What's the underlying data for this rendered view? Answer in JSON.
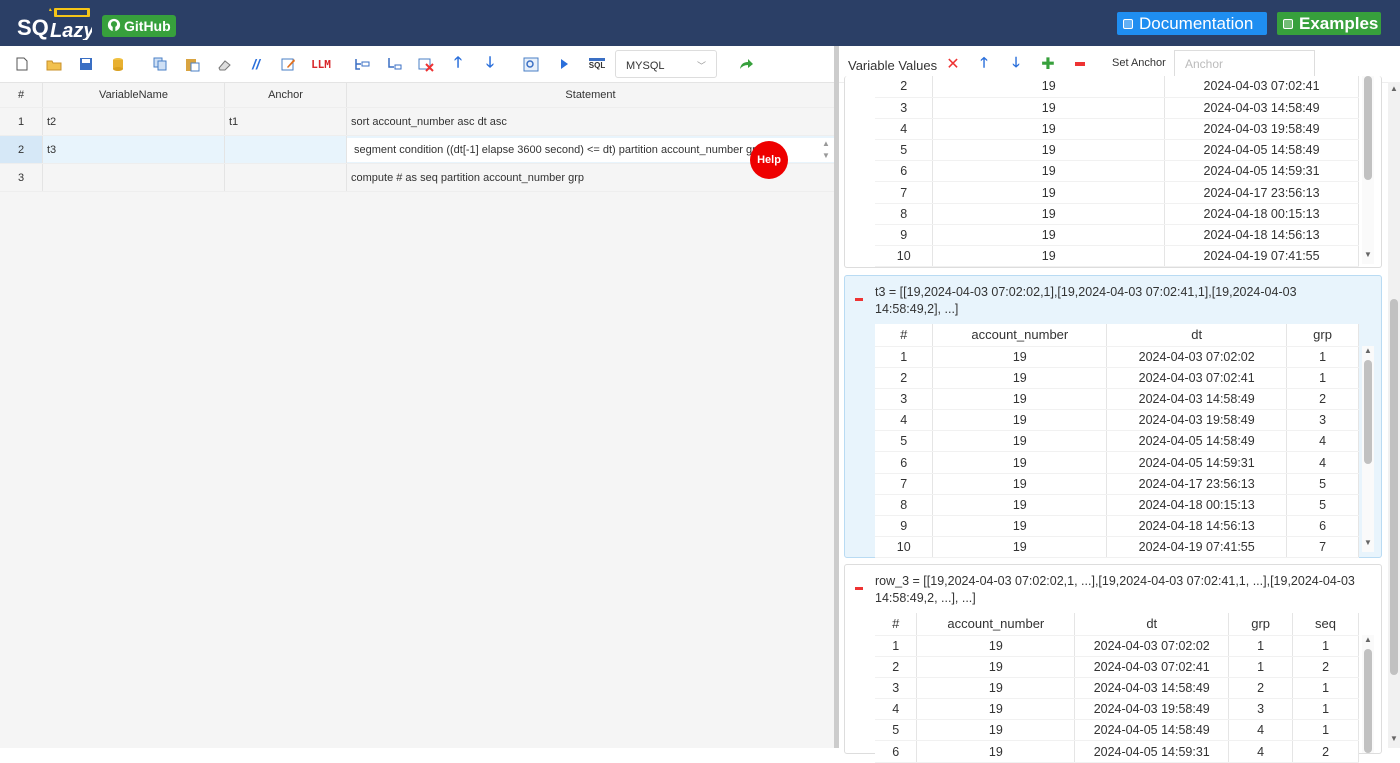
{
  "header": {
    "brand": "SQLazy",
    "github_label": "GitHub",
    "documentation_label": "Documentation",
    "examples_label": "Examples"
  },
  "toolbar": {
    "db_dialect": "MYSQL",
    "llm_label": "LLM",
    "sql_label": "SQL",
    "icons": [
      "new-file-icon",
      "open-folder-icon",
      "save-icon",
      "database-icon",
      "copy-icon",
      "paste-icon",
      "erase-icon",
      "comment-icon",
      "edit-icon",
      "llm-icon",
      "insert-row-icon",
      "append-row-icon",
      "delete-row-icon",
      "move-up-icon",
      "move-down-icon",
      "preview-icon",
      "run-icon",
      "sql-icon",
      "dialect-select",
      "redo-icon"
    ]
  },
  "grid": {
    "headers": [
      "#",
      "VariableName",
      "Anchor",
      "Statement"
    ],
    "rows": [
      {
        "num": "1",
        "var": "t2",
        "anchor": "t1",
        "statement": "sort account_number asc dt asc"
      },
      {
        "num": "2",
        "var": "t3",
        "anchor": "",
        "statement": "segment condition ((dt[-1] elapse 3600 second) <= dt) partition account_number grp"
      },
      {
        "num": "3",
        "var": "",
        "anchor": "",
        "statement": "compute # as seq partition account_number grp"
      }
    ],
    "help_label": "Help"
  },
  "right": {
    "title": "Variable Values",
    "set_anchor_label": "Set Anchor",
    "anchor_placeholder": "Anchor"
  },
  "panels": [
    {
      "id": "t2",
      "title": "",
      "columns": [
        "#",
        "account_number",
        "dt"
      ],
      "rows": [
        [
          "2",
          "19",
          "2024-04-03 07:02:41"
        ],
        [
          "3",
          "19",
          "2024-04-03 14:58:49"
        ],
        [
          "4",
          "19",
          "2024-04-03 19:58:49"
        ],
        [
          "5",
          "19",
          "2024-04-05 14:58:49"
        ],
        [
          "6",
          "19",
          "2024-04-05 14:59:31"
        ],
        [
          "7",
          "19",
          "2024-04-17 23:56:13"
        ],
        [
          "8",
          "19",
          "2024-04-18 00:15:13"
        ],
        [
          "9",
          "19",
          "2024-04-18 14:56:13"
        ],
        [
          "10",
          "19",
          "2024-04-19 07:41:55"
        ]
      ]
    },
    {
      "id": "t3",
      "title": "t3 = [[19,2024-04-03 07:02:02,1],[19,2024-04-03 07:02:41,1],[19,2024-04-03 14:58:49,2], ...]",
      "columns": [
        "#",
        "account_number",
        "dt",
        "grp"
      ],
      "rows": [
        [
          "1",
          "19",
          "2024-04-03 07:02:02",
          "1"
        ],
        [
          "2",
          "19",
          "2024-04-03 07:02:41",
          "1"
        ],
        [
          "3",
          "19",
          "2024-04-03 14:58:49",
          "2"
        ],
        [
          "4",
          "19",
          "2024-04-03 19:58:49",
          "3"
        ],
        [
          "5",
          "19",
          "2024-04-05 14:58:49",
          "4"
        ],
        [
          "6",
          "19",
          "2024-04-05 14:59:31",
          "4"
        ],
        [
          "7",
          "19",
          "2024-04-17 23:56:13",
          "5"
        ],
        [
          "8",
          "19",
          "2024-04-18 00:15:13",
          "5"
        ],
        [
          "9",
          "19",
          "2024-04-18 14:56:13",
          "6"
        ],
        [
          "10",
          "19",
          "2024-04-19 07:41:55",
          "7"
        ]
      ]
    },
    {
      "id": "row_3",
      "title": "row_3 = [[19,2024-04-03 07:02:02,1, ...],[19,2024-04-03 07:02:41,1, ...],[19,2024-04-03 14:58:49,2, ...], ...]",
      "columns": [
        "#",
        "account_number",
        "dt",
        "grp",
        "seq"
      ],
      "rows": [
        [
          "1",
          "19",
          "2024-04-03 07:02:02",
          "1",
          "1"
        ],
        [
          "2",
          "19",
          "2024-04-03 07:02:41",
          "1",
          "2"
        ],
        [
          "3",
          "19",
          "2024-04-03 14:58:49",
          "2",
          "1"
        ],
        [
          "4",
          "19",
          "2024-04-03 19:58:49",
          "3",
          "1"
        ],
        [
          "5",
          "19",
          "2024-04-05 14:58:49",
          "4",
          "1"
        ],
        [
          "6",
          "19",
          "2024-04-05 14:59:31",
          "4",
          "2"
        ]
      ]
    }
  ],
  "colors": {
    "header_bg": "#2b3f66",
    "doc_btn": "#1f8ef1",
    "green_btn": "#37a03c",
    "help_red": "#e00000",
    "selected_row": "#e8f4fc"
  }
}
